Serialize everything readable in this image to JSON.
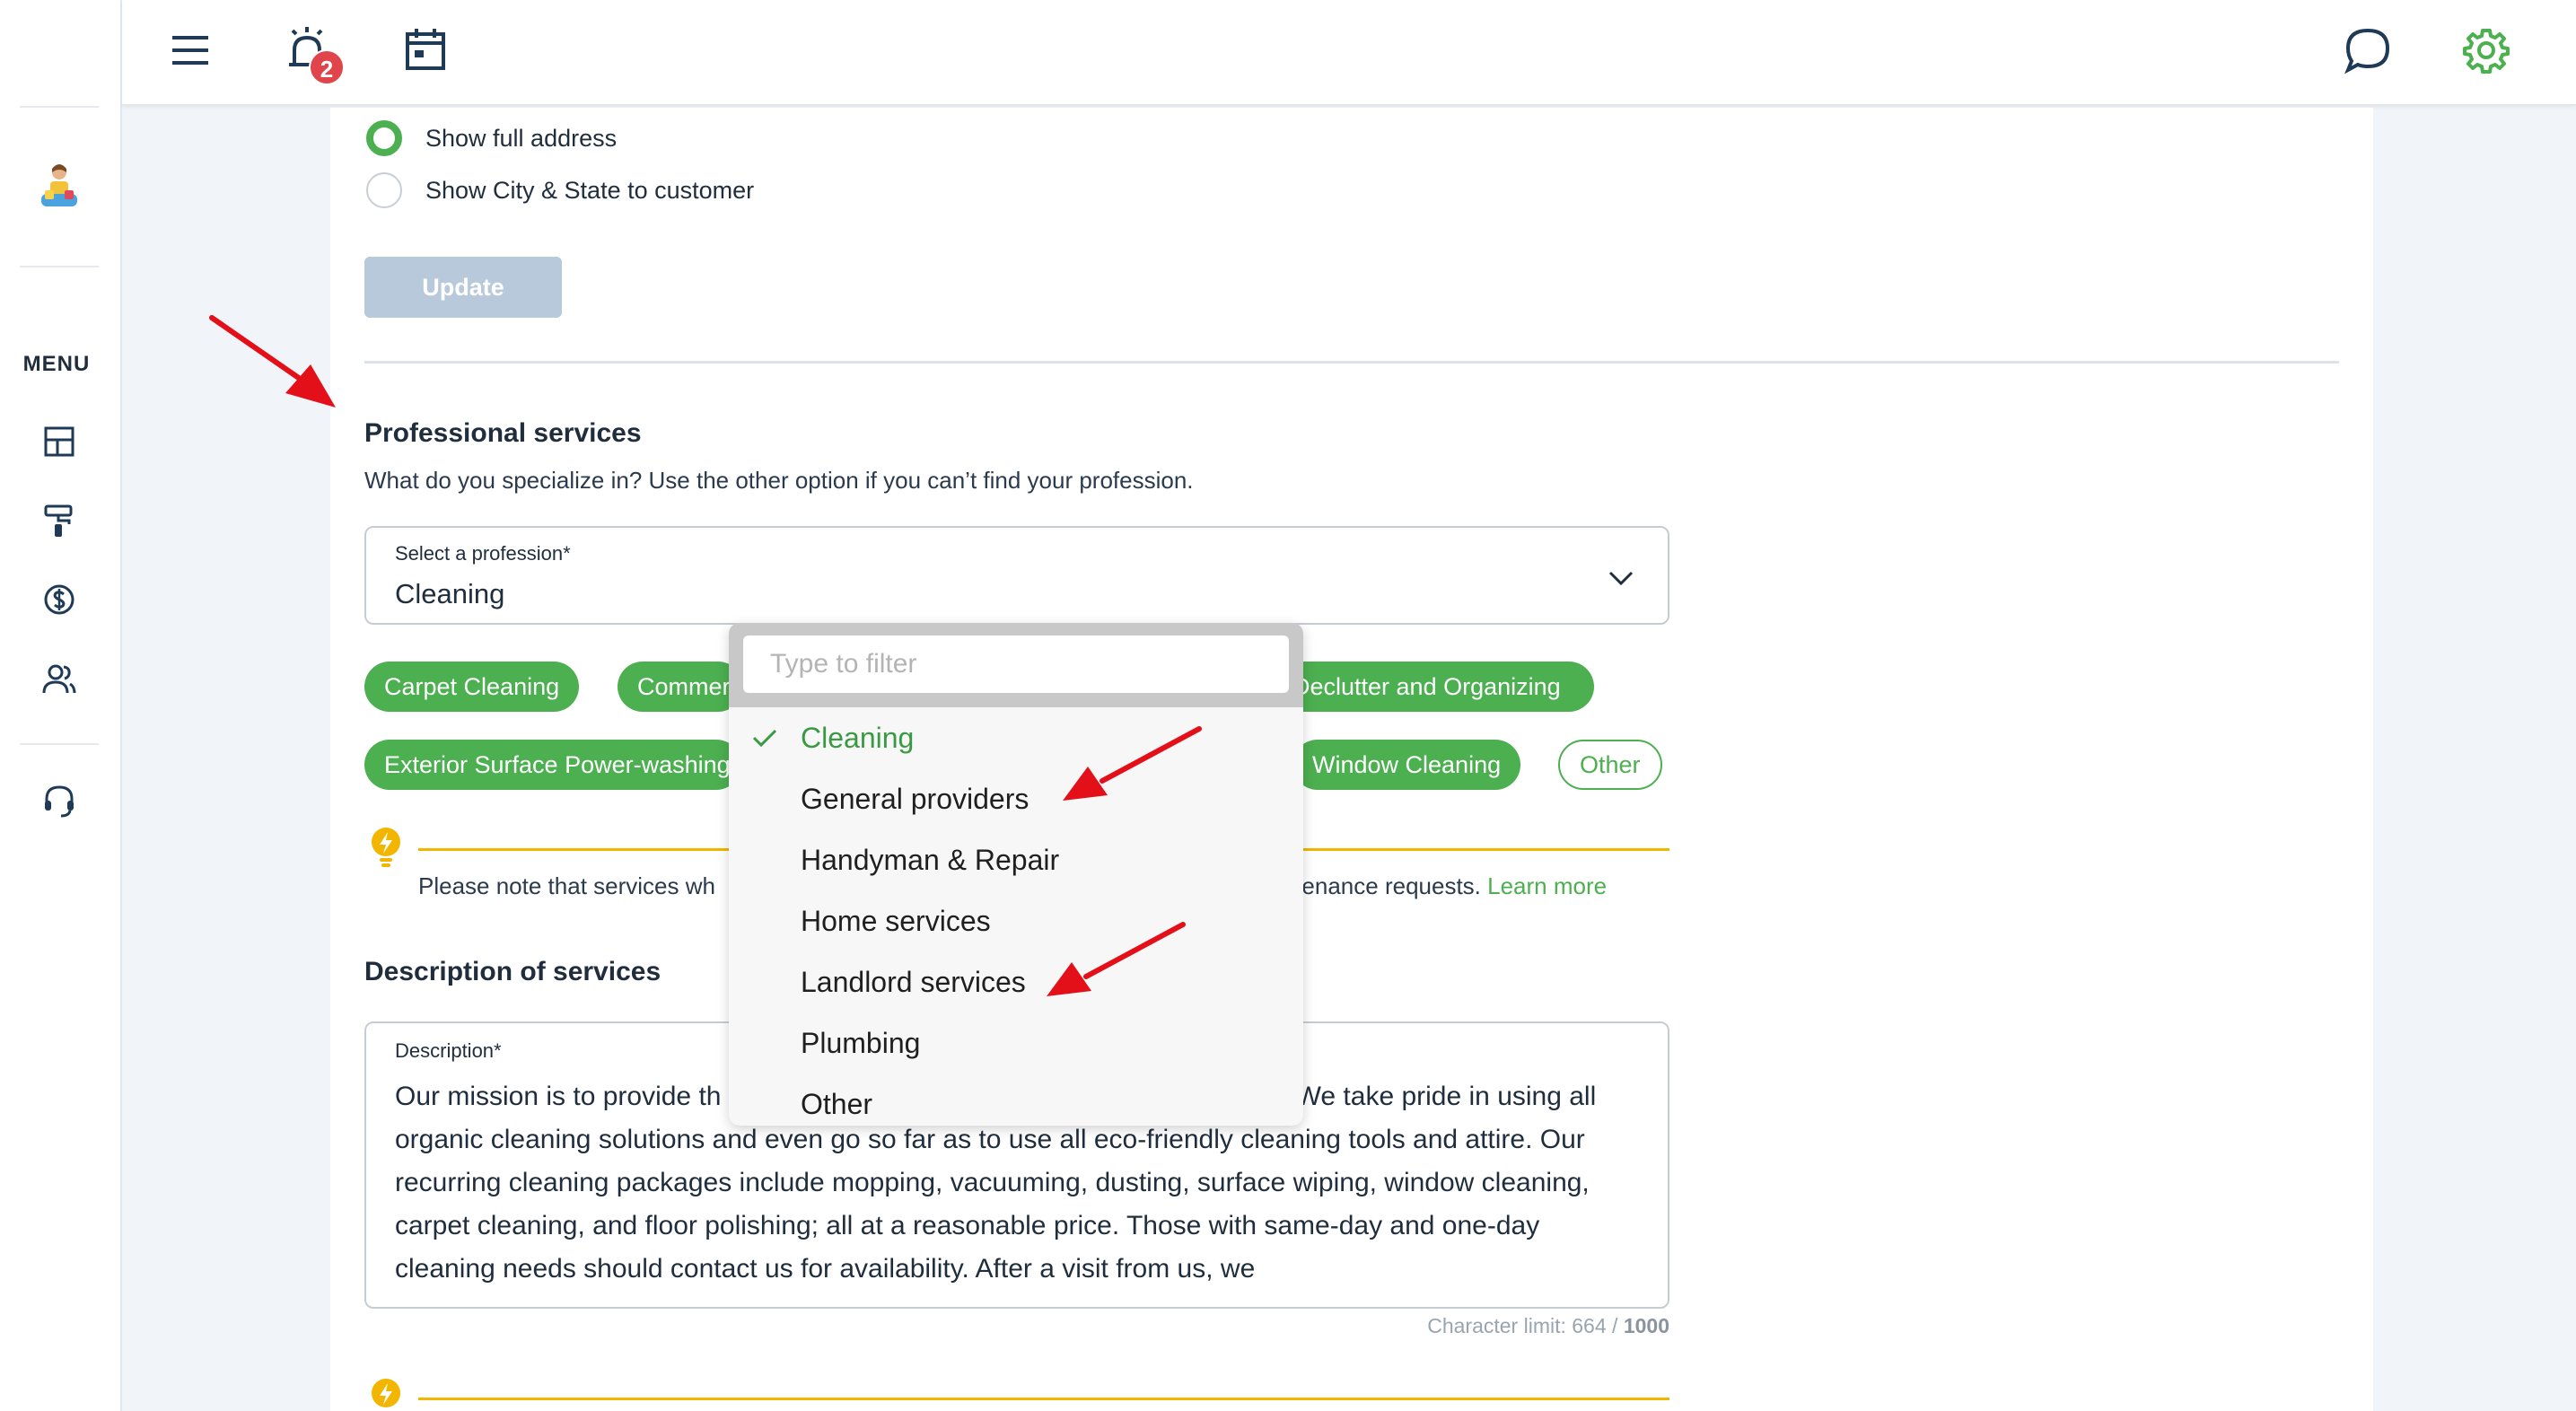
{
  "sidebar": {
    "menu_label": "MENU",
    "icons": [
      "dashboard-icon",
      "paint-roller-icon",
      "dollar-icon",
      "users-icon",
      "support-headset-icon"
    ]
  },
  "topbar": {
    "notification_count": "2",
    "icons": [
      "hamburger-menu-icon",
      "alarm-bell-icon",
      "calendar-icon",
      "chat-bubble-icon",
      "gear-icon"
    ],
    "accent_color": "#4caf50"
  },
  "address": {
    "option_full": "Show full address",
    "option_city_state": "Show City & State to customer",
    "selected": "Show full address",
    "update_label": "Update"
  },
  "professional": {
    "heading": "Professional services",
    "subtext": "What do you specialize in? Use the other option if you can’t find your profession.",
    "select_label": "Select a profession*",
    "select_value": "Cleaning",
    "chips": [
      {
        "label": "Carpet Cleaning",
        "selected": true
      },
      {
        "label": "Commercial Cleaning",
        "selected": true
      },
      {
        "label": "Declutter and Organizing",
        "selected": true
      },
      {
        "label": "Exterior Surface Power-washing",
        "selected": true
      },
      {
        "label": "Window Cleaning",
        "selected": true
      },
      {
        "label": "Other",
        "selected": false
      }
    ],
    "note_start": "Please note that services wh",
    "note_end": "intenance requests. ",
    "learn_more": "Learn more"
  },
  "dropdown": {
    "filter_placeholder": "Type to filter",
    "items": [
      "Cleaning",
      "General providers",
      "Handyman & Repair",
      "Home services",
      "Landlord services",
      "Plumbing",
      "Other"
    ],
    "selected": "Cleaning"
  },
  "description": {
    "heading": "Description of services",
    "label": "Description*",
    "text": "Our mission is to provide th                                                                    gion. We take pride in using all organic cleaning solutions and even go so far as to use all eco-friendly cleaning tools and attire. Our recurring cleaning packages include mopping, vacuuming, dusting, surface wiping, window cleaning, carpet cleaning, and floor polishing; all at a reasonable price. Those with same-day and one-day cleaning needs should contact us for availability. After a visit from us, we",
    "char_limit_label": "Character limit: 664 / ",
    "char_limit_max": "1000"
  },
  "colors": {
    "annotation_arrow": "#e3101a",
    "note_line": "#f2b600"
  }
}
